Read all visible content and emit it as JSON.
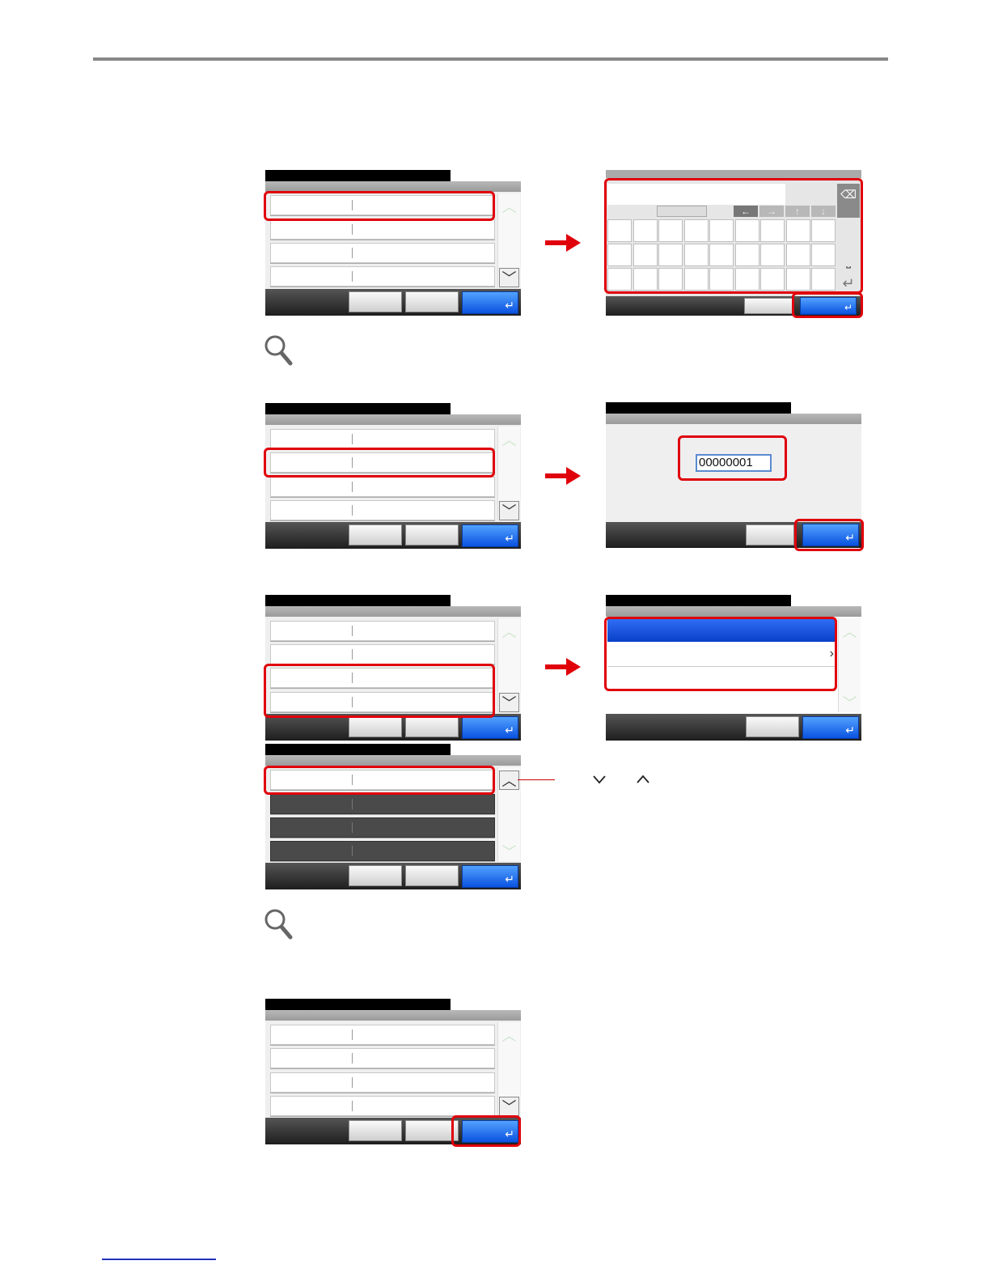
{
  "keyboard": {
    "backspace_icon": "backspace-icon",
    "nav_arrows": [
      "←",
      "→",
      "↑",
      "↓"
    ],
    "space_glyph": "⎵",
    "enter_glyph": "↵"
  },
  "numeric_entry": {
    "value": "00000001"
  },
  "footer": {
    "ok_glyph": "↵"
  },
  "scroll_symbols": {
    "up": "︿",
    "down": "﹀"
  },
  "callout_icons": {
    "down": "chevron-down-icon",
    "up": "chevron-up-icon"
  },
  "colors": {
    "highlight": "#e0000a",
    "accent_blue": "#0a52e0",
    "arrow_red": "#e0000a"
  }
}
